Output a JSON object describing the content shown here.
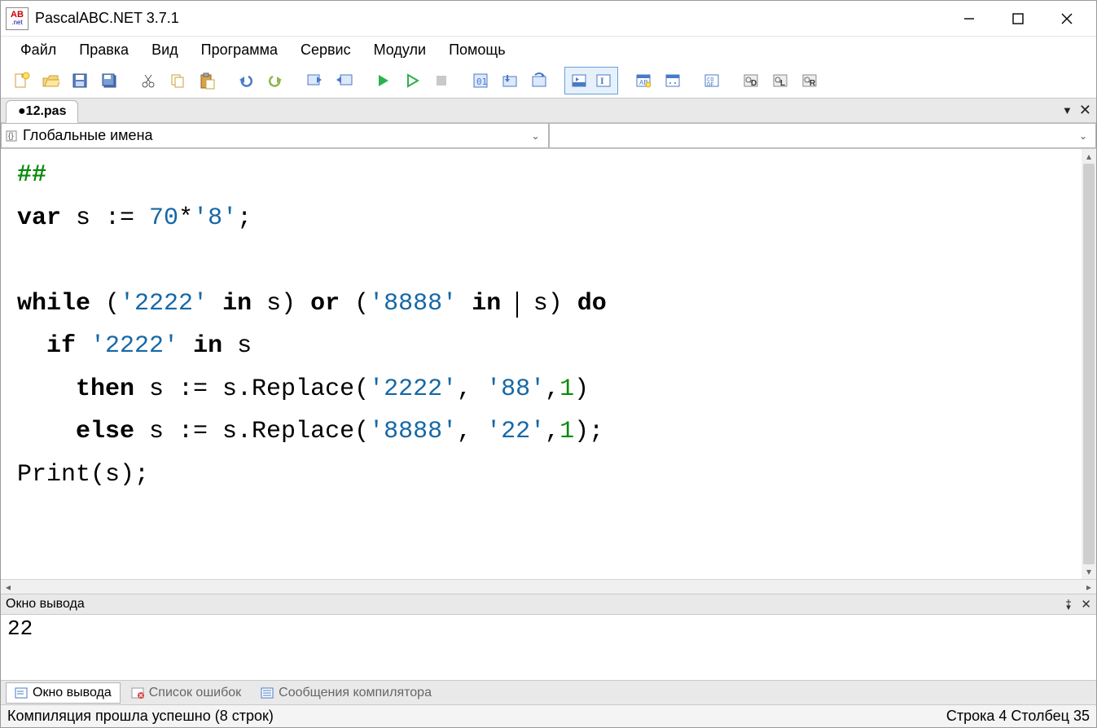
{
  "window": {
    "title": "PascalABC.NET 3.7.1"
  },
  "menu": [
    "Файл",
    "Правка",
    "Вид",
    "Программа",
    "Сервис",
    "Модули",
    "Помощь"
  ],
  "tab": {
    "name": "●12.pas"
  },
  "dropdown": {
    "scope_label": "Глобальные имена"
  },
  "code": {
    "l1_comment": "##",
    "l2_kw_var": "var",
    "l2_rest_a": " s := ",
    "l2_num": "70",
    "l2_rest_b": "*",
    "l2_str": "'8'",
    "l2_rest_c": ";",
    "l4_kw_while": "while",
    "l4_a": " (",
    "l4_str1": "'2222'",
    "l4_b": " ",
    "l4_kw_in1": "in",
    "l4_c": " s) ",
    "l4_kw_or": "or",
    "l4_d": " (",
    "l4_str2": "'8888'",
    "l4_e": " ",
    "l4_kw_in2": "in",
    "l4_f": " ",
    "l4_g": " s) ",
    "l4_kw_do": "do",
    "l5_indent": "  ",
    "l5_kw_if": "if",
    "l5_a": " ",
    "l5_str": "'2222'",
    "l5_b": " ",
    "l5_kw_in": "in",
    "l5_c": " s",
    "l6_indent": "    ",
    "l6_kw_then": "then",
    "l6_a": " s := s.Replace(",
    "l6_str1": "'2222'",
    "l6_b": ", ",
    "l6_str2": "'88'",
    "l6_c": ",",
    "l6_one": "1",
    "l6_d": ")",
    "l7_indent": "    ",
    "l7_kw_else": "else",
    "l7_a": " s := s.Replace(",
    "l7_str1": "'8888'",
    "l7_b": ", ",
    "l7_str2": "'22'",
    "l7_c": ",",
    "l7_one": "1",
    "l7_d": ");",
    "l8": "Print(s);"
  },
  "output": {
    "panel_title": "Окно вывода",
    "text": "22"
  },
  "bottom_tabs": {
    "t1": "Окно вывода",
    "t2": "Список ошибок",
    "t3": "Сообщения компилятора"
  },
  "status": {
    "left": "Компиляция прошла успешно (8 строк)",
    "right": "Строка  4  Столбец  35"
  }
}
